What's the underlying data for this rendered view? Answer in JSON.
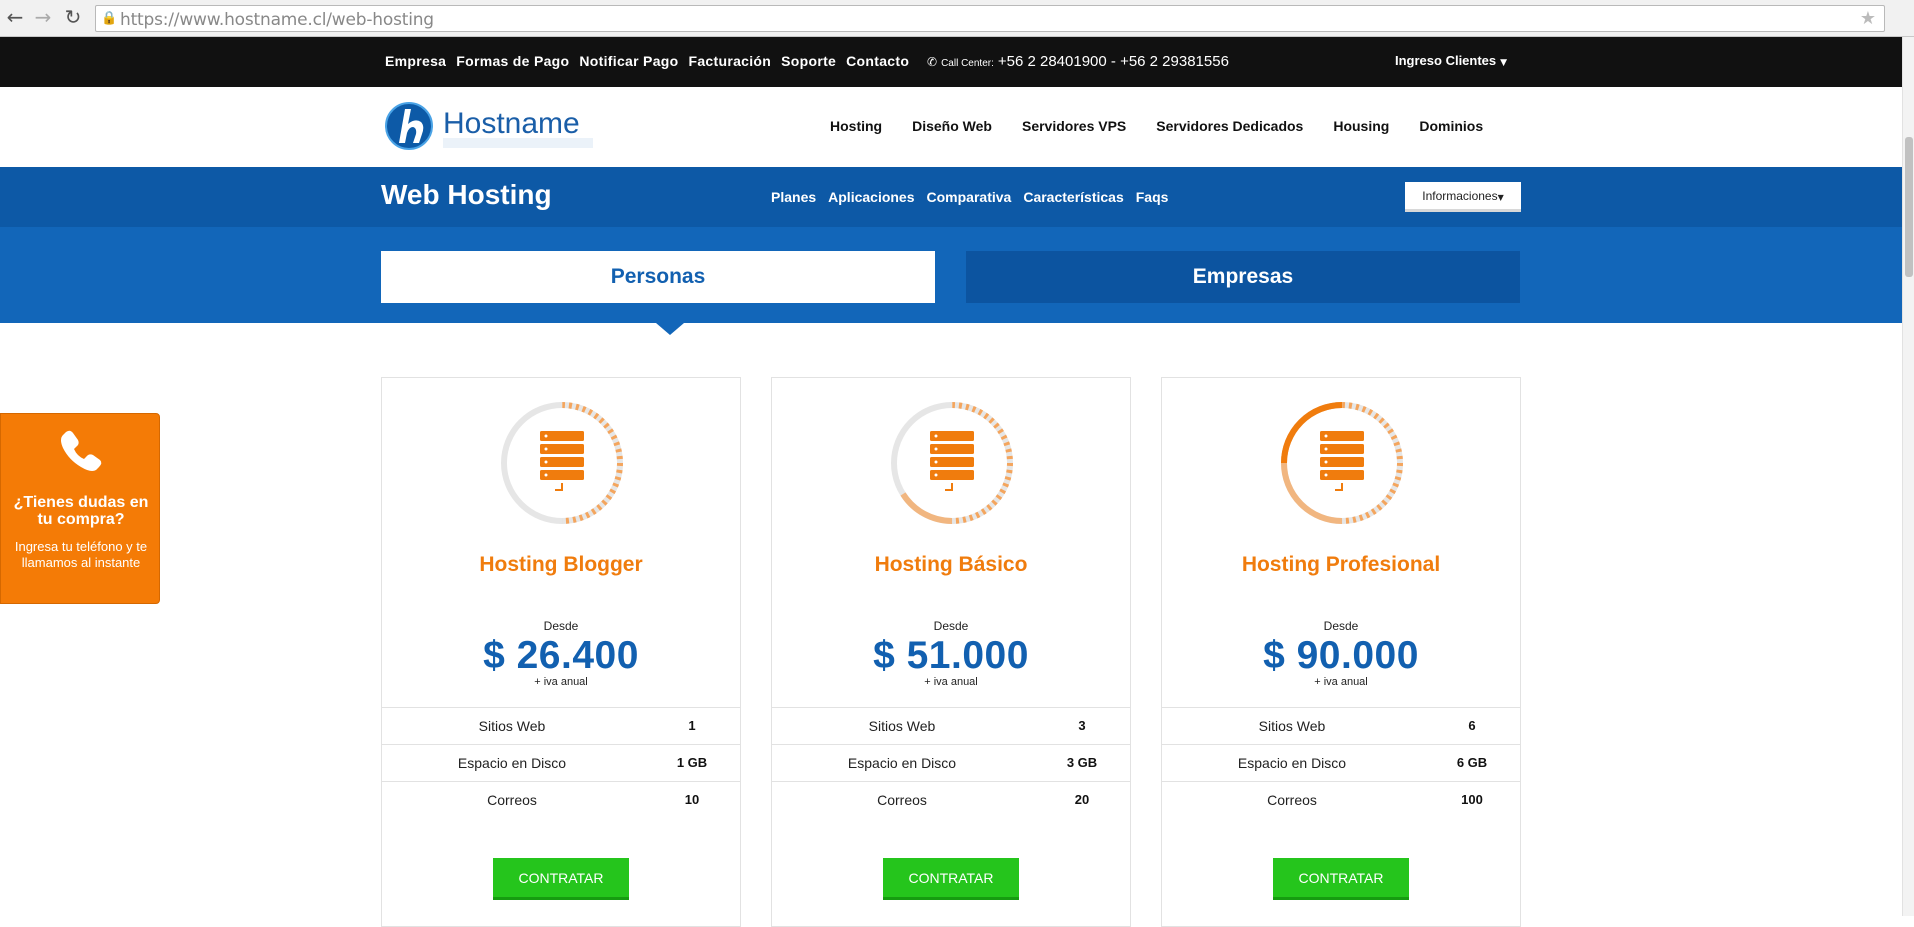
{
  "browser": {
    "url_host": "https://www.hostname.cl",
    "url_path": "/web-hosting"
  },
  "topbar": {
    "links": [
      "Empresa",
      "Formas de Pago",
      "Notificar Pago",
      "Facturación",
      "Soporte",
      "Contacto"
    ],
    "call_label": "Call Center:",
    "phones": "+56 2 28401900 - +56 2 29381556",
    "login": "Ingreso Clientes"
  },
  "header": {
    "logo_text": "Hostname",
    "nav": [
      "Hosting",
      "Diseño Web",
      "Servidores VPS",
      "Servidores Dedicados",
      "Housing",
      "Dominios"
    ]
  },
  "section": {
    "title": "Web Hosting",
    "subnav": [
      "Planes",
      "Aplicaciones",
      "Comparativa",
      "Características",
      "Faqs"
    ],
    "info_button": "Informaciones"
  },
  "tabs": {
    "personas": "Personas",
    "empresas": "Empresas"
  },
  "plans": [
    {
      "name": "Hosting Blogger",
      "desde": "Desde",
      "price": "$ 26.400",
      "iva": "+ iva anual",
      "specs": [
        {
          "label": "Sitios Web",
          "value": "1"
        },
        {
          "label": "Espacio en Disco",
          "value": "1 GB"
        },
        {
          "label": "Correos",
          "value": "10"
        }
      ],
      "button": "CONTRATAR",
      "level": 0.33
    },
    {
      "name": "Hosting Básico",
      "desde": "Desde",
      "price": "$ 51.000",
      "iva": "+ iva anual",
      "specs": [
        {
          "label": "Sitios Web",
          "value": "3"
        },
        {
          "label": "Espacio en Disco",
          "value": "3 GB"
        },
        {
          "label": "Correos",
          "value": "20"
        }
      ],
      "button": "CONTRATAR",
      "level": 0.66
    },
    {
      "name": "Hosting Profesional",
      "desde": "Desde",
      "price": "$ 90.000",
      "iva": "+ iva anual",
      "specs": [
        {
          "label": "Sitios Web",
          "value": "6"
        },
        {
          "label": "Espacio en Disco",
          "value": "6 GB"
        },
        {
          "label": "Correos",
          "value": "100"
        }
      ],
      "button": "CONTRATAR",
      "level": 1.0
    }
  ],
  "side_widget": {
    "title": "¿Tienes dudas en tu compra?",
    "text": "Ingresa tu teléfono y te llamamos al instante"
  },
  "colors": {
    "brand_blue": "#0d59a6",
    "accent_orange": "#f07c0d",
    "cta_green": "#25c51c"
  }
}
